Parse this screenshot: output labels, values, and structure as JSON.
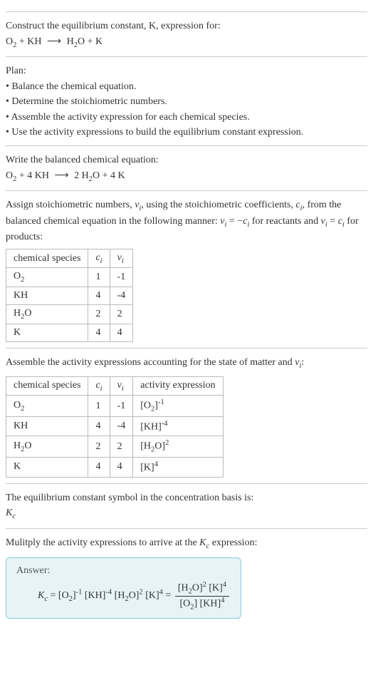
{
  "prompt": {
    "line1": "Construct the equilibrium constant, K, expression for:",
    "equation_html": "O<sub>2</sub> + KH <span class='arrow'>⟶</span> H<sub>2</sub>O + K"
  },
  "plan": {
    "heading": "Plan:",
    "bullets": [
      "Balance the chemical equation.",
      "Determine the stoichiometric numbers.",
      "Assemble the activity expression for each chemical species.",
      "Use the activity expressions to build the equilibrium constant expression."
    ]
  },
  "balanced": {
    "heading": "Write the balanced chemical equation:",
    "equation_html": "O<sub>2</sub> + 4 KH <span class='arrow'>⟶</span> 2 H<sub>2</sub>O + 4 K"
  },
  "stoich": {
    "heading_html": "Assign stoichiometric numbers, <span class='ital'>ν<sub>i</sub></span>, using the stoichiometric coefficients, <span class='ital'>c<sub>i</sub></span>, from the balanced chemical equation in the following manner: <span class='ital'>ν<sub>i</sub></span> = −<span class='ital'>c<sub>i</sub></span> for reactants and <span class='ital'>ν<sub>i</sub></span> = <span class='ital'>c<sub>i</sub></span> for products:",
    "headers": {
      "species": "chemical species",
      "ci_html": "<span class='ital'>c<sub>i</sub></span>",
      "vi_html": "<span class='ital'>ν<sub>i</sub></span>"
    },
    "rows": [
      {
        "species_html": "O<sub>2</sub>",
        "ci": "1",
        "vi": "-1"
      },
      {
        "species_html": "KH",
        "ci": "4",
        "vi": "-4"
      },
      {
        "species_html": "H<sub>2</sub>O",
        "ci": "2",
        "vi": "2"
      },
      {
        "species_html": "K",
        "ci": "4",
        "vi": "4"
      }
    ]
  },
  "activity": {
    "heading_html": "Assemble the activity expressions accounting for the state of matter and <span class='ital'>ν<sub>i</sub></span>:",
    "headers": {
      "species": "chemical species",
      "ci_html": "<span class='ital'>c<sub>i</sub></span>",
      "vi_html": "<span class='ital'>ν<sub>i</sub></span>",
      "activity": "activity expression"
    },
    "rows": [
      {
        "species_html": "O<sub>2</sub>",
        "ci": "1",
        "vi": "-1",
        "expr_html": "[O<sub>2</sub>]<sup>-1</sup>"
      },
      {
        "species_html": "KH",
        "ci": "4",
        "vi": "-4",
        "expr_html": "[KH]<sup>-4</sup>"
      },
      {
        "species_html": "H<sub>2</sub>O",
        "ci": "2",
        "vi": "2",
        "expr_html": "[H<sub>2</sub>O]<sup>2</sup>"
      },
      {
        "species_html": "K",
        "ci": "4",
        "vi": "4",
        "expr_html": "[K]<sup>4</sup>"
      }
    ]
  },
  "symbol": {
    "heading": "The equilibrium constant symbol in the concentration basis is:",
    "symbol_html": "<span class='ital'>K<sub>c</sub></span>"
  },
  "multiply": {
    "heading_html": "Mulitply the activity expressions to arrive at the <span class='ital'>K<sub>c</sub></span> expression:"
  },
  "answer": {
    "label": "Answer:",
    "formula_html": "<span class='ital'>K<sub>c</sub></span> = [O<sub>2</sub>]<sup>-1</sup> [KH]<sup>-4</sup> [H<sub>2</sub>O]<sup>2</sup> [K]<sup>4</sup> = <span class='frac'><span class='num'>[H<sub>2</sub>O]<sup>2</sup> [K]<sup>4</sup></span><span class='den'>[O<sub>2</sub>] [KH]<sup>4</sup></span></span>"
  },
  "chart_data": {
    "type": "table",
    "tables": [
      {
        "title": "Stoichiometric numbers",
        "columns": [
          "chemical species",
          "c_i",
          "ν_i"
        ],
        "rows": [
          [
            "O2",
            1,
            -1
          ],
          [
            "KH",
            4,
            -4
          ],
          [
            "H2O",
            2,
            2
          ],
          [
            "K",
            4,
            4
          ]
        ]
      },
      {
        "title": "Activity expressions",
        "columns": [
          "chemical species",
          "c_i",
          "ν_i",
          "activity expression"
        ],
        "rows": [
          [
            "O2",
            1,
            -1,
            "[O2]^-1"
          ],
          [
            "KH",
            4,
            -4,
            "[KH]^-4"
          ],
          [
            "H2O",
            2,
            2,
            "[H2O]^2"
          ],
          [
            "K",
            4,
            4,
            "[K]^4"
          ]
        ]
      }
    ]
  }
}
